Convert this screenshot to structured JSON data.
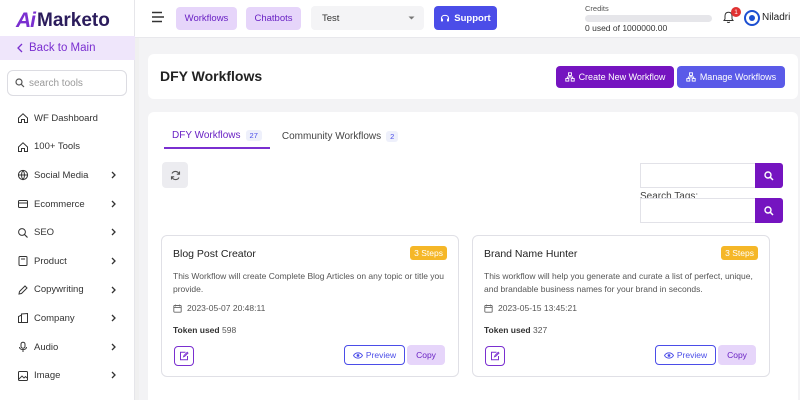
{
  "app": {
    "logo_ai": "Ai",
    "logo_text": "Marketo"
  },
  "sidebar": {
    "back_label": "Back to Main",
    "search_placeholder": "search tools",
    "items": [
      {
        "label": "WF Dashboard",
        "icon": "home-icon",
        "has_arrow": false
      },
      {
        "label": "100+ Tools",
        "icon": "home-icon",
        "has_arrow": false
      },
      {
        "label": "Social Media",
        "icon": "globe-icon",
        "has_arrow": true
      },
      {
        "label": "Ecommerce",
        "icon": "cart-icon",
        "has_arrow": true
      },
      {
        "label": "SEO",
        "icon": "seo-icon",
        "has_arrow": true
      },
      {
        "label": "Product",
        "icon": "product-icon",
        "has_arrow": true
      },
      {
        "label": "Copywriting",
        "icon": "copywriting-icon",
        "has_arrow": true
      },
      {
        "label": "Company",
        "icon": "company-icon",
        "has_arrow": true
      },
      {
        "label": "Audio",
        "icon": "microphone-icon",
        "has_arrow": true
      },
      {
        "label": "Image",
        "icon": "image-icon",
        "has_arrow": true
      }
    ]
  },
  "topbar": {
    "workflows_label": "Workflows",
    "chatbots_label": "Chatbots",
    "select_value": "Test",
    "support_label": "Support",
    "credits_label": "Credits",
    "credits_value": "0 used of 1000000.00",
    "credits_used_fraction": 0,
    "notification_count": "1",
    "username": "Niladri"
  },
  "header": {
    "title": "DFY Workflows",
    "create_label": "Create New Workflow",
    "manage_label": "Manage Workflows"
  },
  "tabs": [
    {
      "label": "DFY Workflows",
      "count": "27"
    },
    {
      "label": "Community Workflows",
      "count": "2"
    }
  ],
  "search": {
    "tags_label": "Search Tags:"
  },
  "cards": [
    {
      "title": "Blog Post Creator",
      "steps": "3 Steps",
      "description": "This Workflow will create Complete Blog Articles on any topic or title you provide.",
      "date": "2023-05-07 20:48:11",
      "token_label": "Token used",
      "token_value": "598",
      "preview_label": "Preview",
      "copy_label": "Copy"
    },
    {
      "title": "Brand Name Hunter",
      "steps": "3 Steps",
      "description": "This workflow will help you generate and curate a list of perfect, unique, and brandable business names for your brand in seconds.",
      "date": "2023-05-15 13:45:21",
      "token_label": "Token used",
      "token_value": "327",
      "preview_label": "Preview",
      "copy_label": "Copy"
    }
  ],
  "colors": {
    "accent": "#7a2fd0",
    "primary": "#4b4de8",
    "badge": "#f5b728"
  }
}
